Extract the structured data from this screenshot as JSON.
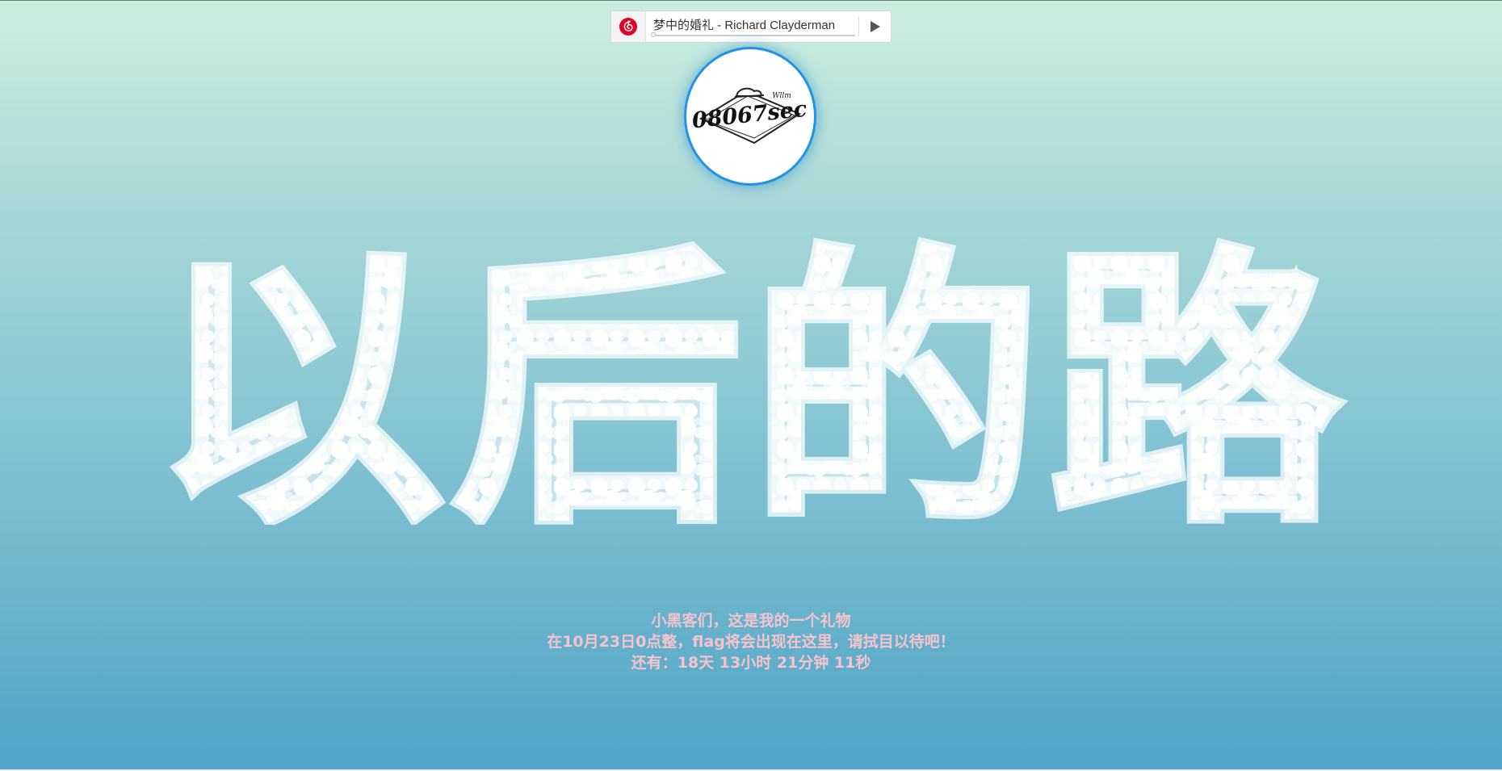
{
  "player": {
    "song": "梦中的婚礼 - Richard Clayderman",
    "progress": 0.0,
    "logo_icon": "netease-music-icon",
    "play_icon": "play-icon",
    "brand_color": "#e60026"
  },
  "avatar": {
    "logo_text": "08067sec",
    "logo_small_text": "Wllm"
  },
  "hero": {
    "text": "以后的路",
    "bubble_color": "#ffffff"
  },
  "message": {
    "line1": "小黑客们，这是我的一个礼物",
    "line2": "在10月23日0点整，flag将会出现在这里，请拭目以待吧！",
    "countdown_prefix": "还有：",
    "days": "18",
    "days_unit": "天",
    "hours": "13",
    "hours_unit": "小时",
    "minutes": "21",
    "minutes_unit": "分钟",
    "seconds": "11",
    "seconds_unit": "秒",
    "color": "#f6c3cc"
  }
}
